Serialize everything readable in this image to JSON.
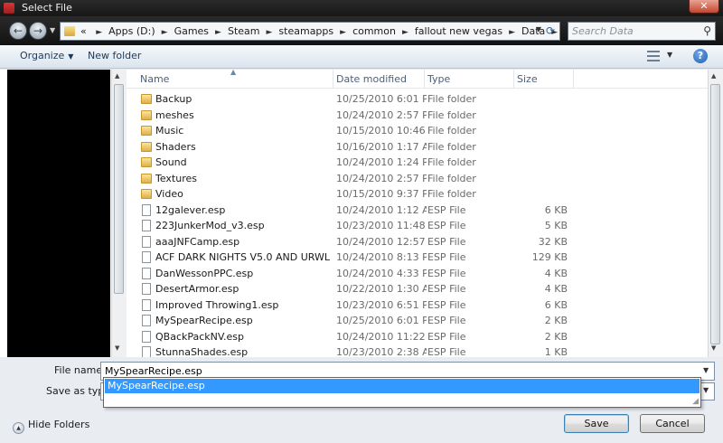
{
  "window": {
    "title": "Select File",
    "close_label": "✕"
  },
  "nav": {
    "back_label": "←",
    "forward_label": "→",
    "breadcrumbs": [
      "Apps (D:)",
      "Games",
      "Steam",
      "steamapps",
      "common",
      "fallout new vegas",
      "Data"
    ],
    "overflow_label": "«",
    "search_placeholder": "Search Data"
  },
  "toolbar": {
    "organize_label": "Organize",
    "new_folder_label": "New folder",
    "help_label": "?"
  },
  "columns": {
    "name": "Name",
    "date": "Date modified",
    "type": "Type",
    "size": "Size"
  },
  "files": [
    {
      "name": "Backup",
      "date": "10/25/2010 6:01 PM",
      "type": "File folder",
      "size": "",
      "kind": "folder"
    },
    {
      "name": "meshes",
      "date": "10/24/2010 2:57 PM",
      "type": "File folder",
      "size": "",
      "kind": "folder"
    },
    {
      "name": "Music",
      "date": "10/15/2010 10:46 ...",
      "type": "File folder",
      "size": "",
      "kind": "folder"
    },
    {
      "name": "Shaders",
      "date": "10/16/2010 1:17 AM",
      "type": "File folder",
      "size": "",
      "kind": "folder"
    },
    {
      "name": "Sound",
      "date": "10/24/2010 1:24 PM",
      "type": "File folder",
      "size": "",
      "kind": "folder"
    },
    {
      "name": "Textures",
      "date": "10/24/2010 2:57 PM",
      "type": "File folder",
      "size": "",
      "kind": "folder"
    },
    {
      "name": "Video",
      "date": "10/15/2010 9:37 PM",
      "type": "File folder",
      "size": "",
      "kind": "folder"
    },
    {
      "name": "12galever.esp",
      "date": "10/24/2010 1:12 AM",
      "type": "ESP File",
      "size": "6 KB",
      "kind": "file"
    },
    {
      "name": "223JunkerMod_v3.esp",
      "date": "10/23/2010 11:48 ...",
      "type": "ESP File",
      "size": "5 KB",
      "kind": "file"
    },
    {
      "name": "aaaJNFCamp.esp",
      "date": "10/24/2010 12:57 ...",
      "type": "ESP File",
      "size": "32 KB",
      "kind": "file"
    },
    {
      "name": "ACF DARK NIGHTS V5.0 AND URWLNV V...",
      "date": "10/24/2010 8:13 PM",
      "type": "ESP File",
      "size": "129 KB",
      "kind": "file"
    },
    {
      "name": "DanWessonPPC.esp",
      "date": "10/24/2010 4:33 PM",
      "type": "ESP File",
      "size": "4 KB",
      "kind": "file"
    },
    {
      "name": "DesertArmor.esp",
      "date": "10/22/2010 1:30 AM",
      "type": "ESP File",
      "size": "4 KB",
      "kind": "file"
    },
    {
      "name": "Improved Throwing1.esp",
      "date": "10/23/2010 6:51 PM",
      "type": "ESP File",
      "size": "6 KB",
      "kind": "file"
    },
    {
      "name": "MySpearRecipe.esp",
      "date": "10/25/2010 6:01 PM",
      "type": "ESP File",
      "size": "2 KB",
      "kind": "file"
    },
    {
      "name": "QBackPackNV.esp",
      "date": "10/24/2010 11:22 ...",
      "type": "ESP File",
      "size": "2 KB",
      "kind": "file"
    },
    {
      "name": "StunnaShades.esp",
      "date": "10/23/2010 2:38 AM",
      "type": "ESP File",
      "size": "1 KB",
      "kind": "file"
    }
  ],
  "form": {
    "file_name_label": "File name:",
    "file_name_value": "MySpearRecipe.esp",
    "save_as_type_label": "Save as type:",
    "save_as_type_value": "",
    "autocomplete_item": "MySpearRecipe.esp"
  },
  "footer": {
    "hide_folders_label": "Hide Folders",
    "save_label": "Save",
    "cancel_label": "Cancel"
  },
  "colors": {
    "selection": "#3399ff",
    "toolbar_text": "#1e395b",
    "window_bg": "#e9edf2"
  }
}
